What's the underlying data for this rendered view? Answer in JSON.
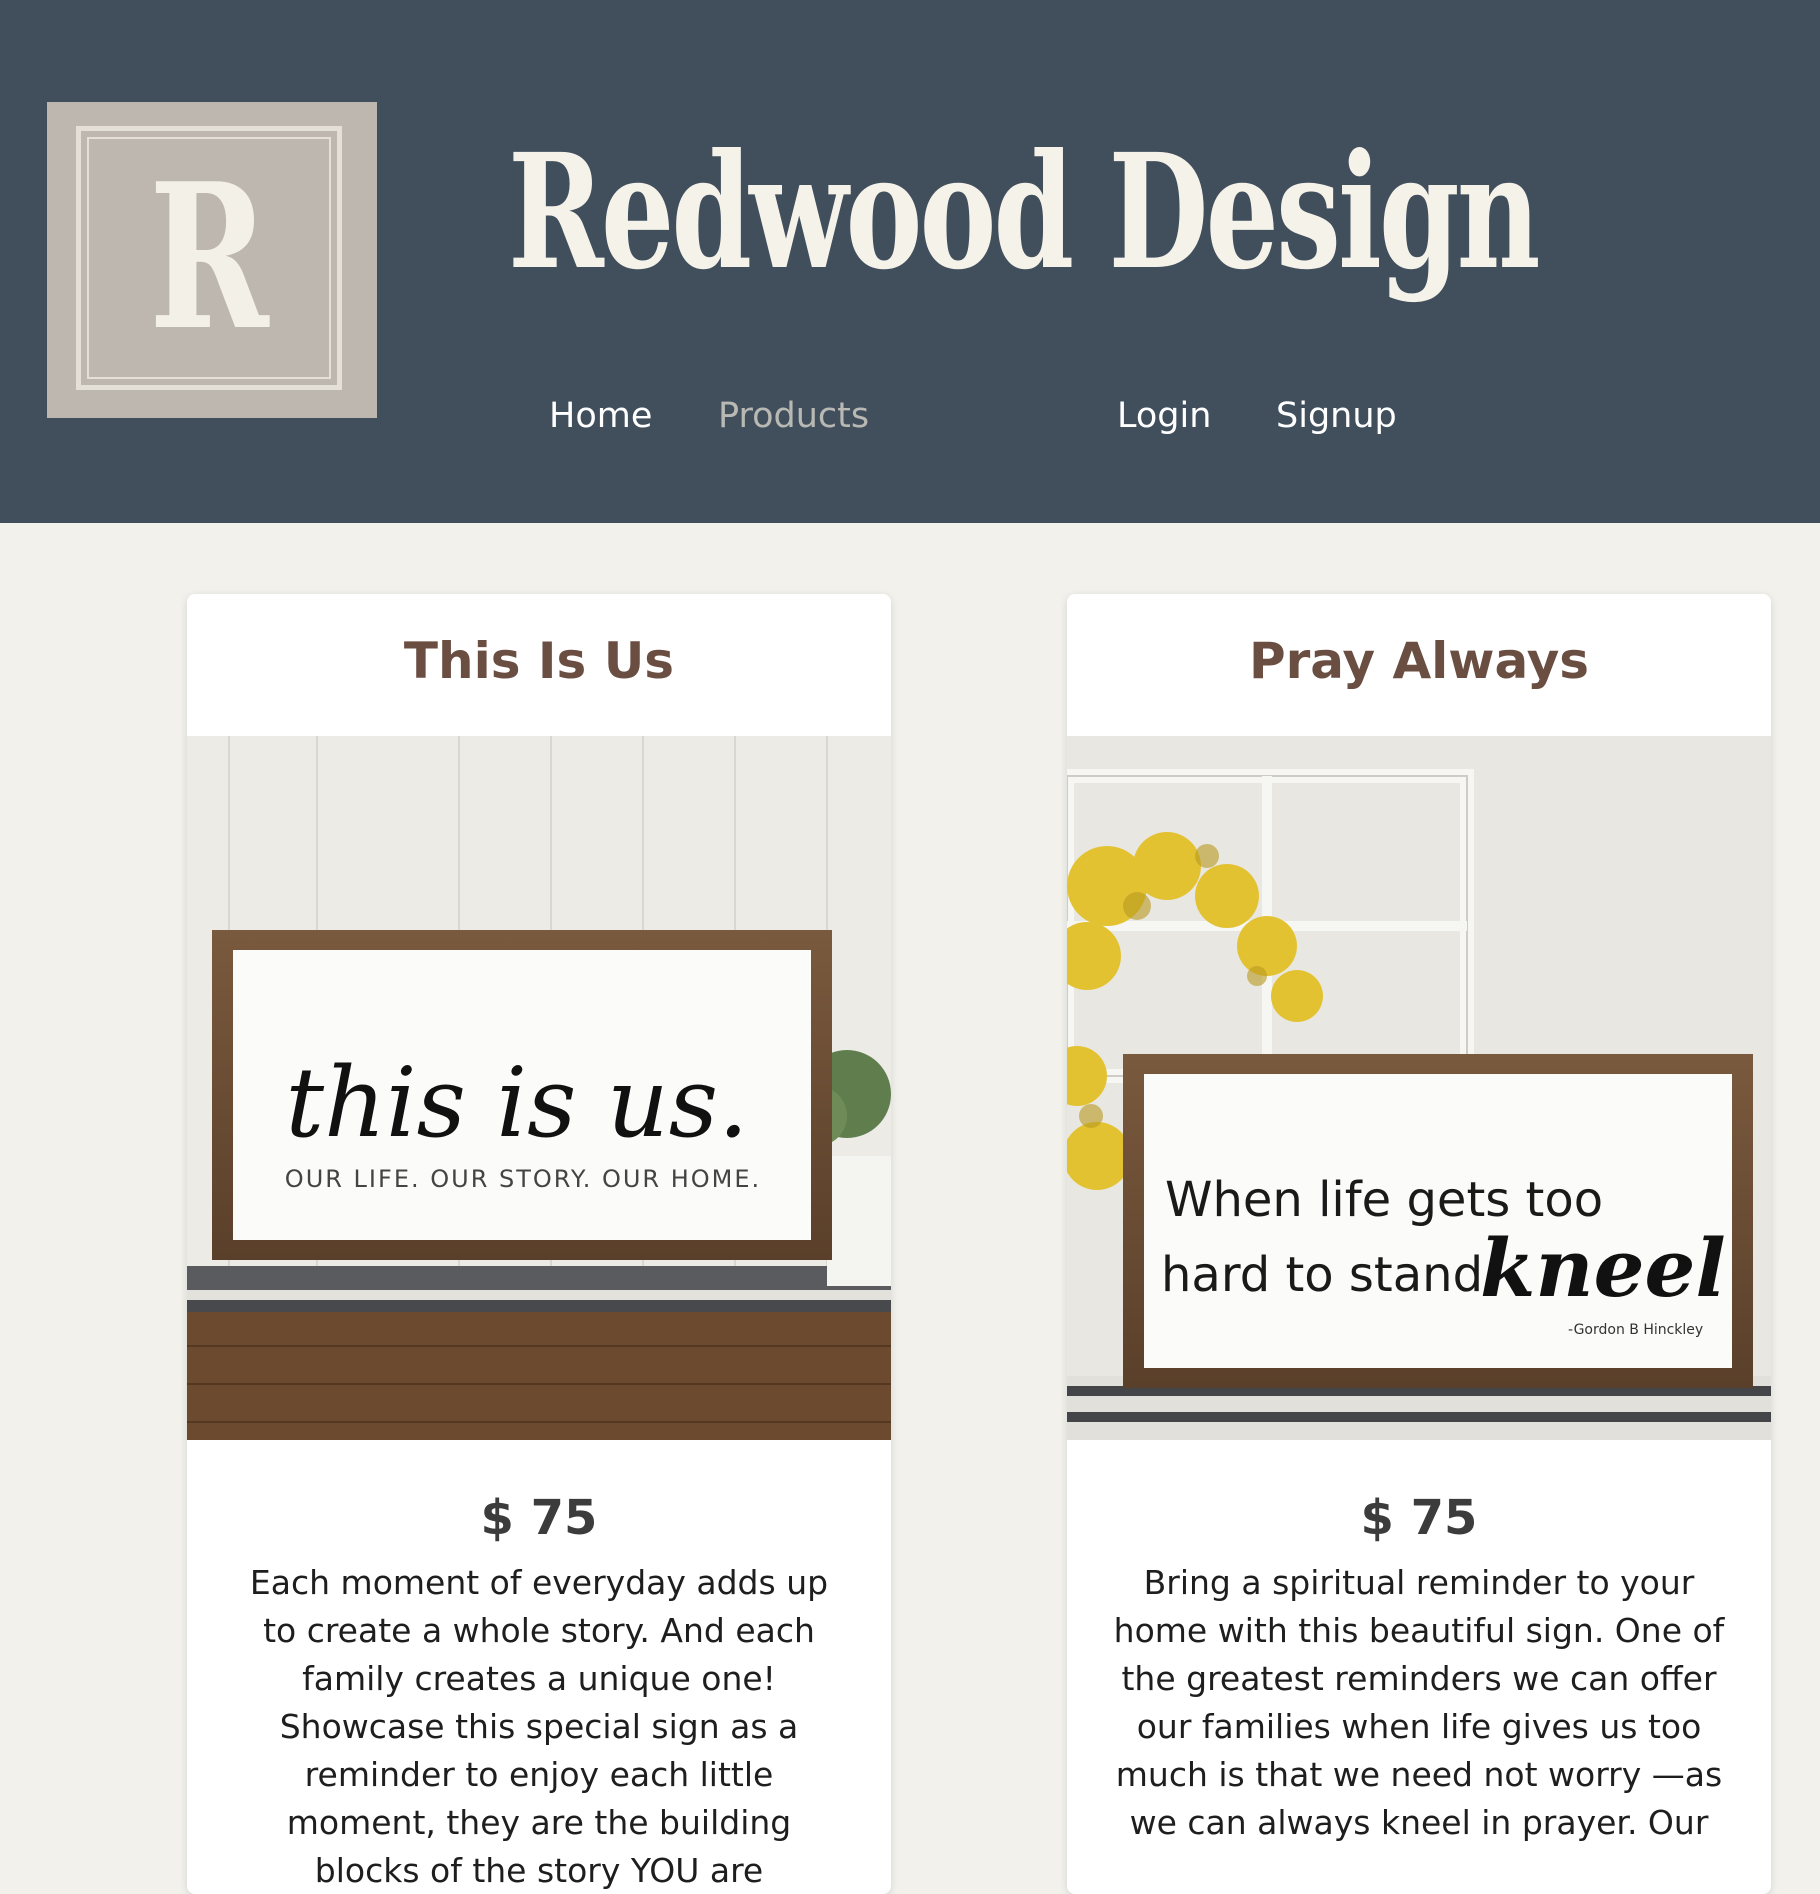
{
  "header": {
    "logo_letter": "R",
    "site_title": "Redwood Design"
  },
  "nav": {
    "home": "Home",
    "products": "Products",
    "login": "Login",
    "signup": "Signup"
  },
  "products": [
    {
      "title": "This Is Us",
      "price": "$ 75",
      "description": "Each moment of everyday adds up to create a whole story. And each family creates a unique one! Showcase this special sign as a reminder to enjoy each little moment, they are the building blocks of the story YOU are",
      "sign_line1": "this is us.",
      "sign_line2": "OUR LIFE.  OUR STORY.  OUR HOME."
    },
    {
      "title": "Pray Always",
      "price": "$ 75",
      "description": "Bring a spiritual reminder to your home with this beautiful sign. One of the greatest reminders we can offer our families when life gives us too much is that we need not worry —as we can always kneel in prayer. Our",
      "sign_line1": "When life gets  too",
      "sign_line2a": "hard to stand",
      "sign_line2b": "kneel",
      "sign_author": "-Gordon B Hinckley"
    }
  ],
  "colors": {
    "header_bg": "#414f5d",
    "page_bg": "#f2f1ec",
    "title_brown": "#6b4e42",
    "logo_bg": "#bdb7b0"
  }
}
